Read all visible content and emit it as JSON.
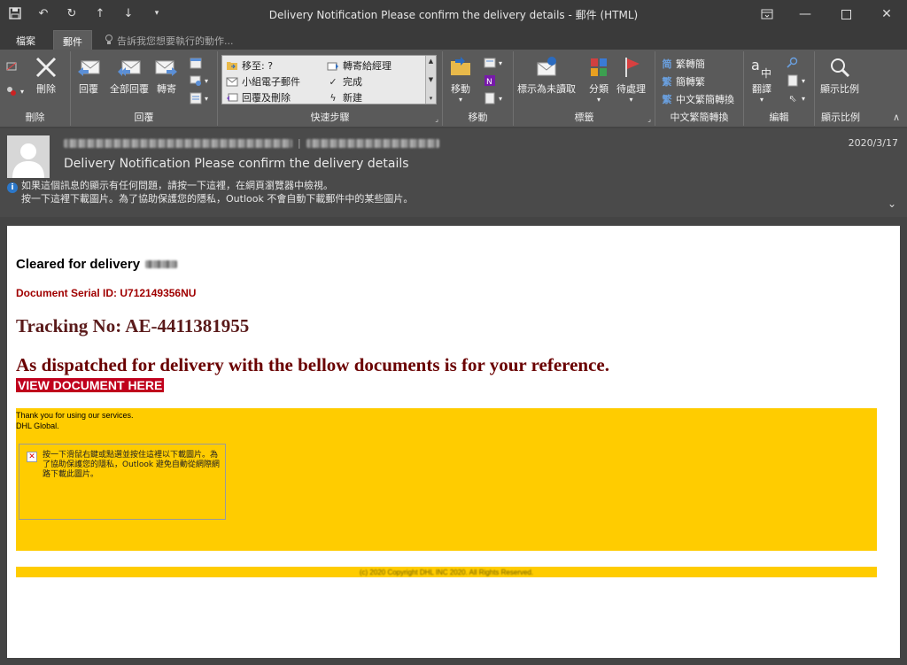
{
  "window": {
    "title": "Delivery Notification  Please confirm the delivery details - 郵件 (HTML)"
  },
  "tabs": {
    "file": "檔案",
    "mail": "郵件",
    "tell_me": "告訴我您想要執行的動作..."
  },
  "ribbon": {
    "delete_group": {
      "label": "刪除",
      "delete": "刪除"
    },
    "respond_group": {
      "label": "回覆",
      "reply": "回覆",
      "reply_all": "全部回覆",
      "forward": "轉寄"
    },
    "quick_steps": {
      "label": "快速步驟",
      "move_to": "移至: ?",
      "team_email": "小組電子郵件",
      "reply_delete": "回覆及刪除",
      "to_manager": "轉寄給經理",
      "done": "完成",
      "create_new": "新建"
    },
    "move_group": {
      "label": "移動",
      "move": "移動"
    },
    "tags_group": {
      "label": "標籤",
      "mark_unread": "標示為未讀取",
      "categorize": "分類",
      "follow_up": "待處理"
    },
    "chinese_group": {
      "label": "中文繁簡轉換",
      "to_trad": "繁轉簡",
      "to_simp": "簡轉繁",
      "convert": "中文繁簡轉換"
    },
    "editing_group": {
      "label": "編輯",
      "translate": "翻譯"
    },
    "zoom_group": {
      "label": "顯示比例",
      "zoom": "顯示比例"
    }
  },
  "message": {
    "date": "2020/3/17",
    "subject": "Delivery Notification  Please confirm the delivery details",
    "info_line1": "如果這個訊息的顯示有任何問題，請按一下這裡，在網頁瀏覽器中檢視。",
    "info_line2": "按一下這裡下載圖片。為了協助保護您的隱私，Outlook 不會自動下載郵件中的某些圖片。"
  },
  "body": {
    "cleared": "Cleared for delivery",
    "serial": "Document Serial ID: U712149356NU",
    "tracking": "Tracking No: AE-4411381955",
    "dispatched": "As dispatched for delivery with the bellow documents is for your reference.",
    "view_document": "VIEW DOCUMENT HERE",
    "thanks_line1": "Thank you for using our services.",
    "thanks_line2": "DHL Global.",
    "image_placeholder": "按一下滑鼠右鍵或點選並按住這裡以下載圖片。為了協助保護您的隱私，Outlook 避免自動從網際網路下載此圖片。",
    "footer": "(c) 2020 Copyright DHL INC 2020. All Rights Reserved."
  },
  "colors": {
    "accent_red": "#c0001c",
    "dhl_yellow": "#ffcc00",
    "title_text": "#5a1a1a"
  }
}
